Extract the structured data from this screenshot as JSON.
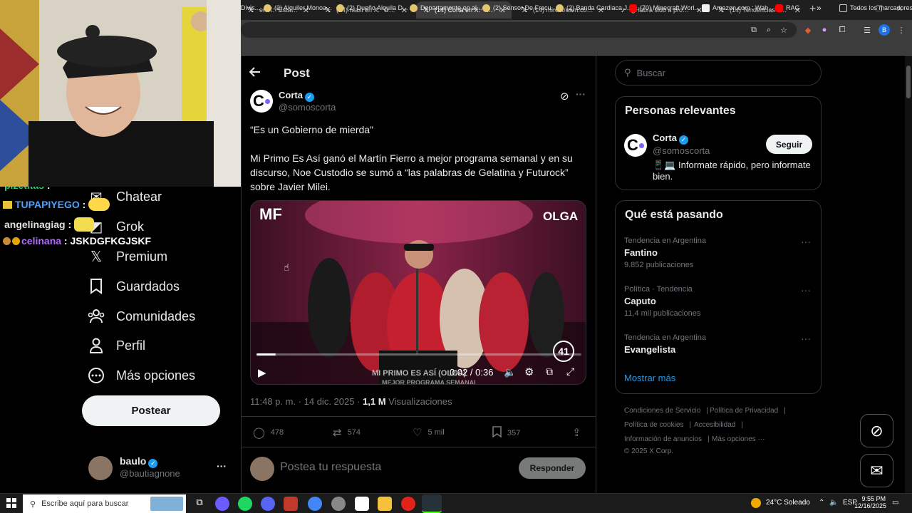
{
  "browser": {
    "tabs": [
      {
        "label": "en X: \"Esta marge",
        "icon": "x-icon",
        "active": false
      },
      {
        "label": "(14) maxi en X: \"GANARO",
        "icon": "x-icon",
        "active": false
      },
      {
        "label": "(14) Corta en X: \"\"Es un G",
        "icon": "x-icon",
        "active": true
      },
      {
        "label": "(14) mirostream.com en X",
        "icon": "x-icon",
        "active": false
      },
      {
        "label": "¿Habrá sido a propósito",
        "icon": "tiktok-icon",
        "active": false
      },
      {
        "label": "(14) Tendencias en Argen",
        "icon": "x-icon",
        "active": false
      }
    ],
    "bookmarks": [
      "Divis...",
      "(2) Alquiler Monoa...",
      "(2) Dueño Alquila D...",
      "Departamento en al...",
      "(2) Sensor De Frecu...",
      "(2) Banda Cardiaca J...",
      "(70) Minecraft Worl...",
      "Amazon.com : Wah...",
      "RAG",
      "Todos los marcadores"
    ],
    "overflow": "»"
  },
  "stream_chat": [
    {
      "user": "pizetitas",
      "text": "",
      "color": "#2ecc71"
    },
    {
      "user": "TUPAPIYEGO",
      "text": "",
      "color": "#4aa3ff"
    },
    {
      "user": "angelinagiag",
      "text": "",
      "color": "#e0e0e0"
    },
    {
      "user": "celinana",
      "text": "JSKDGFKGJSKF",
      "color": "#b06bff"
    }
  ],
  "sidebar": {
    "items": [
      {
        "label": "Chatear",
        "icon": "chat-icon"
      },
      {
        "label": "Grok",
        "icon": "grok-icon"
      },
      {
        "label": "Premium",
        "icon": "x-logo-icon"
      },
      {
        "label": "Guardados",
        "icon": "bookmark-icon"
      },
      {
        "label": "Comunidades",
        "icon": "communities-icon"
      },
      {
        "label": "Perfil",
        "icon": "profile-icon"
      },
      {
        "label": "Más opciones",
        "icon": "more-options-icon"
      }
    ],
    "post_button": "Postear",
    "account": {
      "name": "baulo",
      "handle": "@bautiagnone",
      "more": "···"
    }
  },
  "post": {
    "header": "Post",
    "author": {
      "name": "Corta",
      "handle": "@somoscorta",
      "avatar_letter": "C"
    },
    "quote": "“Es un Gobierno de mierda”",
    "body": "Mi Primo Es Así ganó el Martín Fierro a mejor programa semanal y en su discurso, Noe Custodio se sumó a “las palabras de Gelatina y Futurock” sobre Javier Milei.",
    "video": {
      "logo_left": "MF",
      "logo_right": "OLGA",
      "lower_third": "MI PRIMO ES ASÍ (OLGA)",
      "lower_third_sub": "MEJOR PROGRAMA SEMANAL",
      "channel_badge": "41",
      "time": "0:02 / 0:36",
      "progress": 0.06
    },
    "meta": {
      "time": "11:48 p. m. · 14 dic. 2025 · ",
      "views_count": "1,1 M",
      "views_label": " Visualizaciones"
    },
    "actions": {
      "replies": "478",
      "reposts": "574",
      "likes": "5 mil",
      "bookmarks": "357"
    },
    "reply_placeholder": "Postea tu respuesta",
    "reply_button": "Responder"
  },
  "right": {
    "search_placeholder": "Buscar",
    "relevant": {
      "title": "Personas relevantes",
      "name": "Corta",
      "handle": "@somoscorta",
      "bio": "📱💻 Informate rápido, pero informate bien.",
      "follow": "Seguir"
    },
    "trends": {
      "title": "Qué está pasando",
      "items": [
        {
          "context": "Tendencia en Argentina",
          "name": "Fantino",
          "count": "9.852 publicaciones"
        },
        {
          "context": "Política · Tendencia",
          "name": "Caputo",
          "count": "11,4 mil publicaciones"
        },
        {
          "context": "Tendencia en Argentina",
          "name": "Evangelista",
          "count": ""
        }
      ],
      "show_more": "Mostrar más"
    },
    "footer": {
      "links": [
        "Condiciones de Servicio",
        "Política de Privacidad",
        "Política de cookies",
        "Accesibilidad",
        "Información de anuncios",
        "Más opciones ···"
      ],
      "copyright": "© 2025 X Corp."
    }
  },
  "taskbar": {
    "search_placeholder": "Escribe aquí para buscar",
    "weather": "24°C  Soleado",
    "language": "ESP",
    "time": "9:55 PM",
    "date": "12/16/2025"
  }
}
